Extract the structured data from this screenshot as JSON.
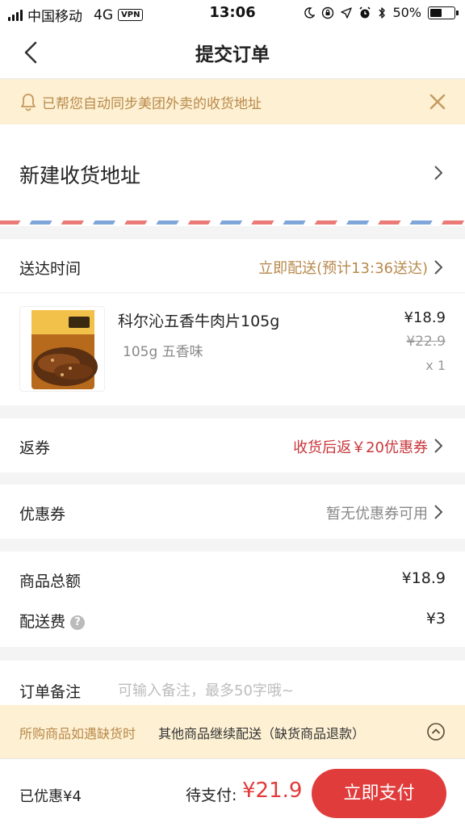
{
  "status_bar": {
    "carrier": "中国移动",
    "network": "4G",
    "vpn": "VPN",
    "time": "13:06",
    "battery": "50%",
    "battery_level": 0.5
  },
  "nav": {
    "title": "提交订单"
  },
  "notice": {
    "text": "已帮您自动同步美团外卖的收货地址"
  },
  "address": {
    "label": "新建收货地址"
  },
  "delivery": {
    "label": "送达时间",
    "value": "立即配送(预计13:36送达)",
    "value_color": "#b8894c"
  },
  "item": {
    "name": "科尔沁五香牛肉片105g",
    "spec": "105g 五香味",
    "price": "¥18.9",
    "original_price": "¥22.9",
    "quantity": "x 1"
  },
  "rebate": {
    "label": "返券",
    "value": "收货后返￥20优惠券",
    "value_color": "#c8353a"
  },
  "coupon": {
    "label": "优惠券",
    "value": "暂无优惠券可用"
  },
  "summary": {
    "goods_total_label": "商品总额",
    "goods_total": "¥18.9",
    "delivery_fee_label": "配送费",
    "delivery_fee": "¥3"
  },
  "remark": {
    "label": "订单备注",
    "placeholder": "可输入备注，最多50字哦~"
  },
  "stock_notice": {
    "condition": "所购商品如遇缺货时",
    "option": "其他商品继续配送（缺货商品退款）"
  },
  "footer": {
    "discount": "已优惠¥4",
    "to_pay_label": "待支付:",
    "total": "¥21.9",
    "pay_button": "立即支付",
    "accent": "#e03c3c"
  },
  "icons": [
    "signal-icon",
    "vpn-badge",
    "moon-icon",
    "lock-rotation-icon",
    "location-icon",
    "alarm-icon",
    "bluetooth-icon",
    "battery-icon",
    "back-chevron-icon",
    "bell-icon",
    "close-icon",
    "chevron-right-icon",
    "help-icon",
    "chevron-up-circle-icon"
  ]
}
